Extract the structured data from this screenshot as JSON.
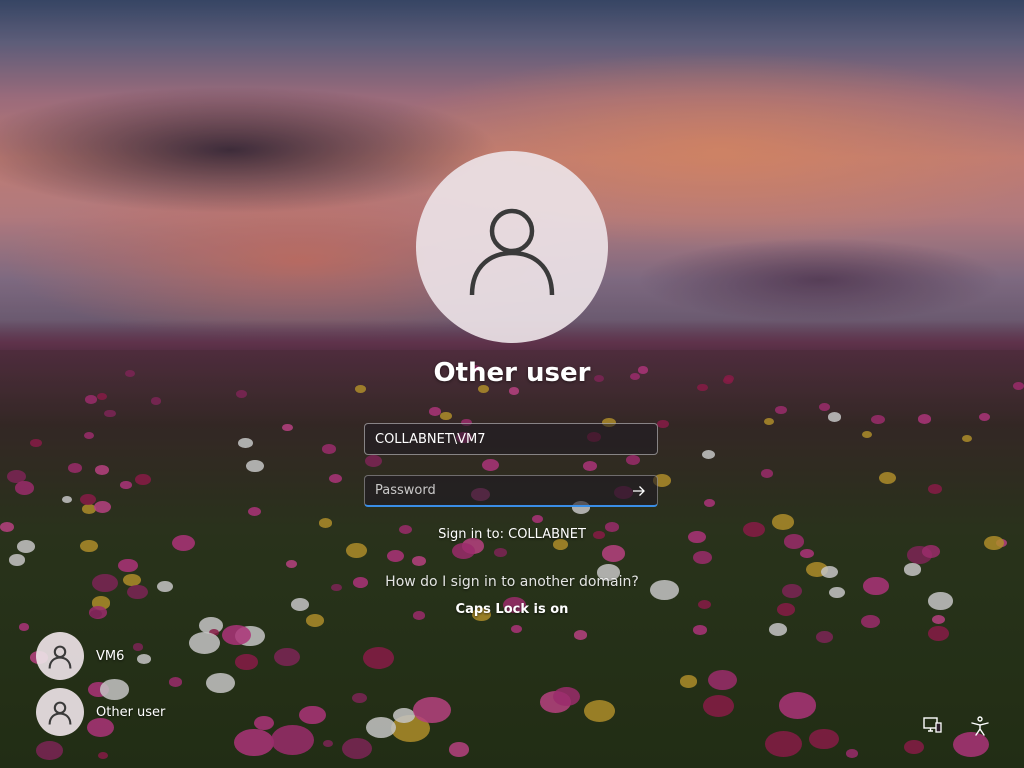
{
  "login": {
    "display_name": "Other user",
    "username_value": "COLLABNET\\VM7",
    "password_placeholder": "Password",
    "sign_in_to": "Sign in to: COLLABNET",
    "other_domain_link": "How do I sign in to another domain?",
    "caps_lock_warning": "Caps Lock is on"
  },
  "user_list": [
    {
      "name": "VM6"
    },
    {
      "name": "Other user"
    }
  ],
  "icons": {
    "avatar": "user-icon",
    "submit": "arrow-right-icon",
    "network": "network-icon",
    "accessibility": "accessibility-icon"
  },
  "colors": {
    "focus_accent": "#3a8ee6",
    "avatar_bg": "#ece2e6"
  }
}
